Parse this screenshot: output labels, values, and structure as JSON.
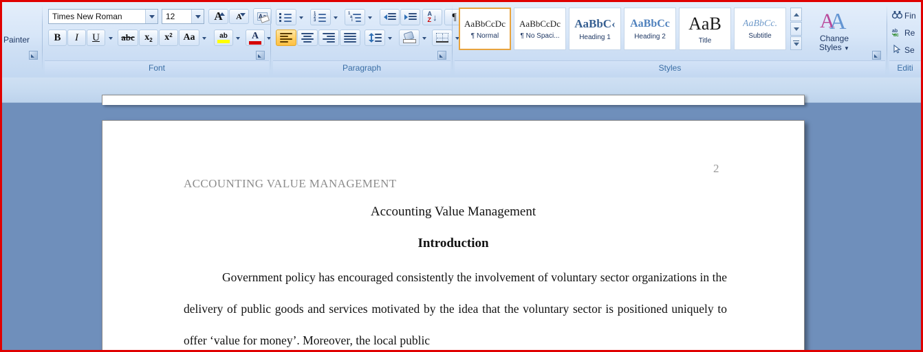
{
  "ribbon": {
    "clipboard": {
      "label_partial": "Painter"
    },
    "font": {
      "group_label": "Font",
      "font_name": "Times New Roman",
      "font_size": "12",
      "buttons": [
        {
          "name": "grow-font",
          "label": "A"
        },
        {
          "name": "shrink-font",
          "label": "A"
        },
        {
          "name": "clear-formatting",
          "label": "Aa"
        },
        {
          "name": "bold",
          "label": "B"
        },
        {
          "name": "italic",
          "label": "I"
        },
        {
          "name": "underline",
          "label": "U"
        },
        {
          "name": "strikethrough",
          "label": "abc"
        },
        {
          "name": "subscript",
          "label": "x₂"
        },
        {
          "name": "superscript",
          "label": "x²"
        },
        {
          "name": "change-case",
          "label": "Aa"
        },
        {
          "name": "text-highlight-color",
          "label": "ab"
        },
        {
          "name": "font-color",
          "label": "A"
        }
      ]
    },
    "paragraph": {
      "group_label": "Paragraph",
      "buttons": [
        {
          "name": "bullets",
          "label": "Bullets"
        },
        {
          "name": "numbering",
          "label": "Numbering"
        },
        {
          "name": "multilevel-list",
          "label": "Multilevel List"
        },
        {
          "name": "decrease-indent",
          "label": "Decrease Indent"
        },
        {
          "name": "increase-indent",
          "label": "Increase Indent"
        },
        {
          "name": "sort",
          "label": "Sort"
        },
        {
          "name": "show-formatting-marks",
          "label": "¶"
        },
        {
          "name": "align-left",
          "label": "Align Left"
        },
        {
          "name": "align-center",
          "label": "Center"
        },
        {
          "name": "align-right",
          "label": "Align Right"
        },
        {
          "name": "justify",
          "label": "Justify"
        },
        {
          "name": "line-spacing",
          "label": "Line Spacing"
        },
        {
          "name": "shading",
          "label": "Shading"
        },
        {
          "name": "borders",
          "label": "Borders"
        }
      ]
    },
    "styles": {
      "group_label": "Styles",
      "gallery": [
        {
          "sample": "AaBbCcDc",
          "name": "¶ Normal",
          "selected": true
        },
        {
          "sample": "AaBbCcDc",
          "name": "¶ No Spaci...",
          "selected": false
        },
        {
          "sample": "AaBbC‹",
          "name": "Heading 1",
          "selected": false
        },
        {
          "sample": "AaBbCc",
          "name": "Heading 2",
          "selected": false
        },
        {
          "sample": "AaB",
          "name": "Title",
          "selected": false
        },
        {
          "sample": "AaBbCc.",
          "name": "Subtitle",
          "selected": false
        }
      ],
      "change_styles": "Change\nStyles"
    },
    "editing": {
      "group_label": "Editi",
      "items": [
        {
          "name": "find",
          "label": "Fin"
        },
        {
          "name": "replace",
          "label": "Re"
        },
        {
          "name": "select",
          "label": "Se"
        }
      ]
    }
  },
  "document": {
    "page_number": "2",
    "running_header": "ACCOUNTING VALUE MANAGEMENT",
    "title": "Accounting Value Management",
    "section_heading": "Introduction",
    "body_paragraph": "Government policy has encouraged consistently the involvement of voluntary sector organizations in the delivery of public goods and services motivated by the idea that the voluntary sector is positioned uniquely to offer ‘value for money’. Moreover, the local public"
  },
  "colors": {
    "border_highlight": "#e00000",
    "workspace": "#6f8fbb",
    "ribbon_label": "#3a6ea5",
    "selection_orange": "#e8a33d",
    "highlight_yellow": "#ffff00",
    "font_color_red": "#d40000"
  }
}
